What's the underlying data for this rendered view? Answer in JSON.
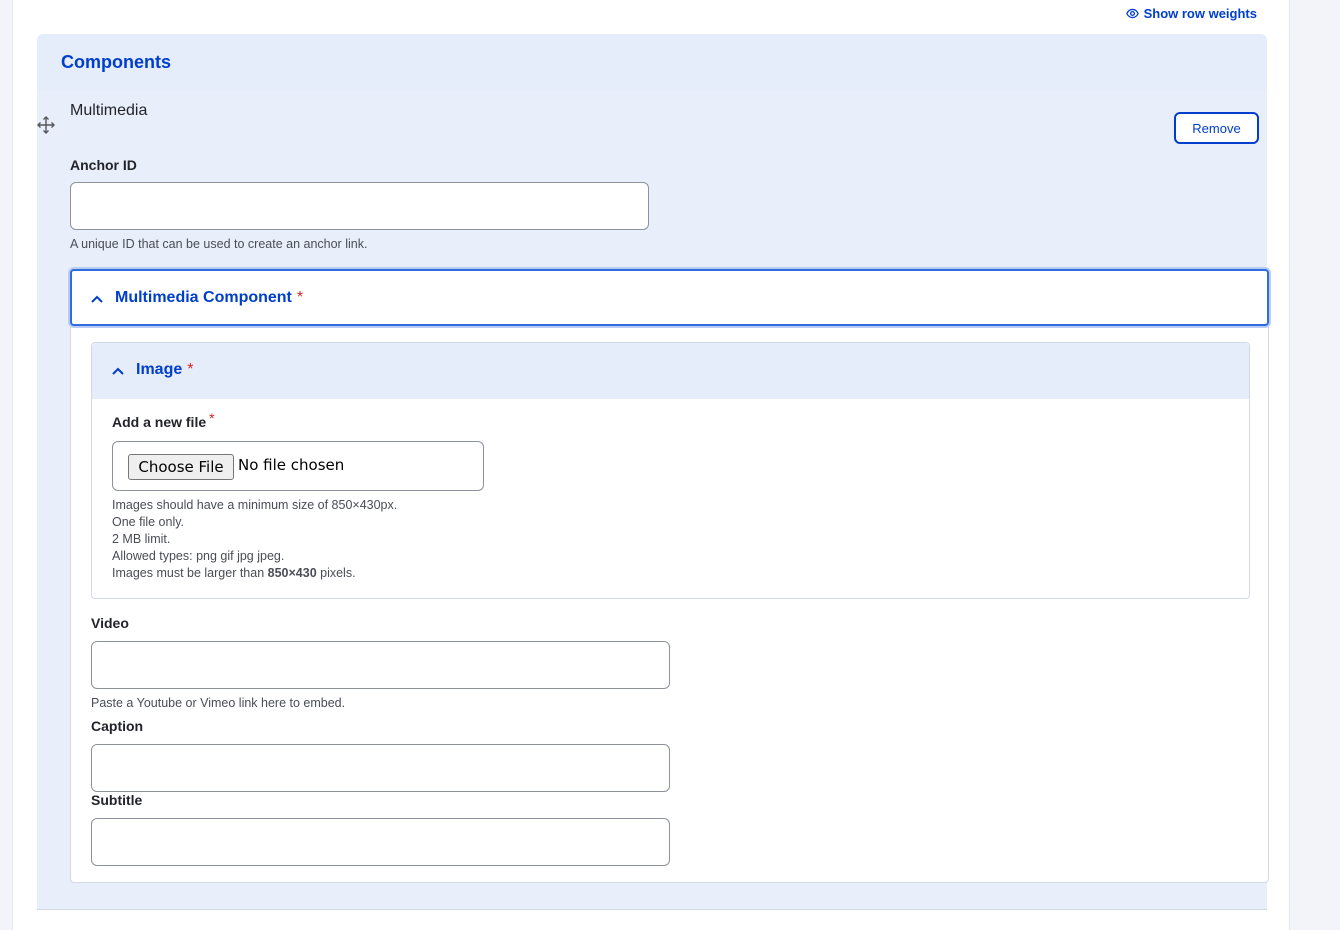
{
  "toolbar": {
    "show_row_weights": "Show row weights",
    "show_row_weights_icon": "eye-icon"
  },
  "components": {
    "title": "Components"
  },
  "row": {
    "drag_icon": "move-icon",
    "title": "Multimedia",
    "remove_label": "Remove",
    "anchor": {
      "label": "Anchor ID",
      "value": "",
      "help": "A unique ID that can be used to create an anchor link."
    },
    "multimedia_component": {
      "label": "Multimedia Component",
      "required_marker": "*",
      "expanded_icon": "chevron-up-icon",
      "image": {
        "label": "Image",
        "required_marker": "*",
        "add_file_label": "Add a new file",
        "add_file_required": "*",
        "choose_button": "Choose File",
        "no_file_text": "No file chosen",
        "help_lines": [
          "Images should have a minimum size of 850×430px.",
          "One file only.",
          "2 MB limit.",
          "Allowed types: png gif jpg jpeg."
        ],
        "help_last_prefix": "Images must be larger than ",
        "help_last_bold": "850×430",
        "help_last_suffix": " pixels."
      },
      "video": {
        "label": "Video",
        "value": "",
        "help": "Paste a Youtube or Vimeo link here to embed."
      },
      "caption": {
        "label": "Caption",
        "value": ""
      },
      "subtitle": {
        "label": "Subtitle",
        "value": ""
      }
    }
  },
  "colors": {
    "accent": "#003ecc",
    "required": "#d72222",
    "row_background": "#e8eefa"
  }
}
